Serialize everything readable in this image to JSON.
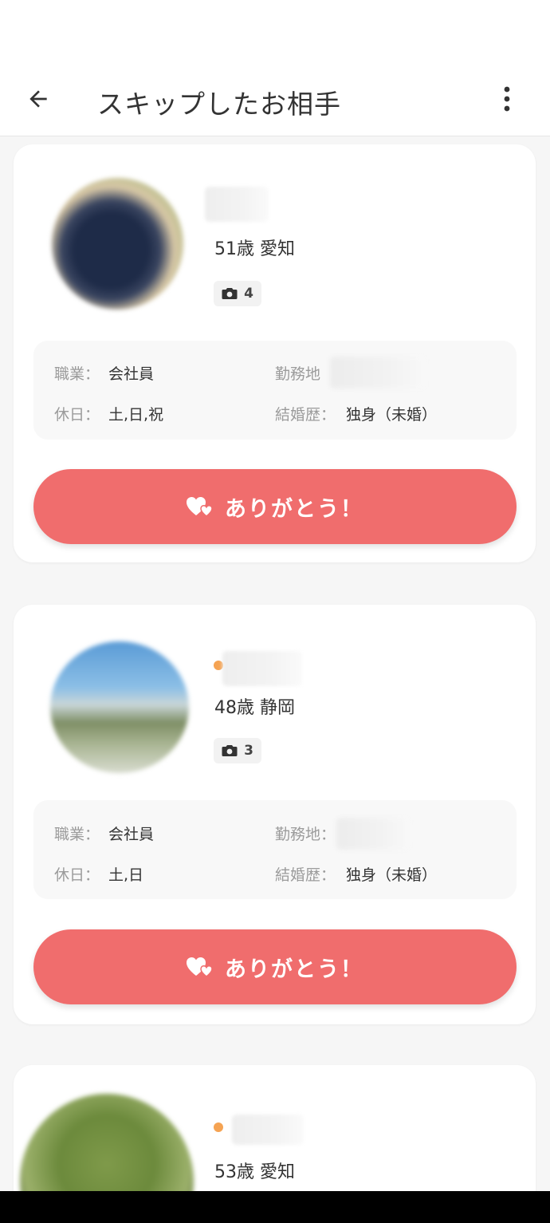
{
  "header": {
    "title": "スキップしたお相手",
    "back_icon": "arrow-left-icon",
    "more_icon": "more-vertical-icon"
  },
  "colors": {
    "accent": "#f06d6d",
    "online": "#f5a353",
    "label": "#9b9b9b",
    "text": "#333333"
  },
  "cards": [
    {
      "age_location": "51歳 愛知",
      "photo_count": "4",
      "online": false,
      "occupation_label": "職業：",
      "occupation": "会社員",
      "workplace_label": "勤務地",
      "holiday_label": "休日：",
      "holiday": "土,日,祝",
      "marital_label": "結婚歴：",
      "marital": "独身（未婚）",
      "button_label": "ありがとう！"
    },
    {
      "age_location": "48歳 静岡",
      "photo_count": "3",
      "online": true,
      "occupation_label": "職業：",
      "occupation": "会社員",
      "workplace_label": "勤務地：",
      "holiday_label": "休日：",
      "holiday": "土,日",
      "marital_label": "結婚歴：",
      "marital": "独身（未婚）",
      "button_label": "ありがとう！"
    },
    {
      "age_location": "53歳 愛知",
      "online": true
    }
  ]
}
